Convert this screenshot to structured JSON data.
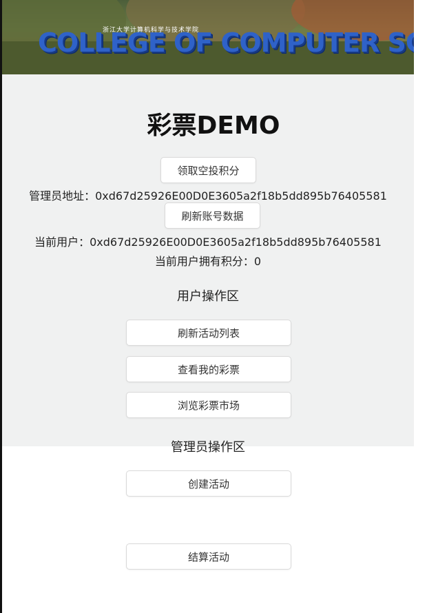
{
  "banner": {
    "subtitle": "浙江大学计算机科学与技术学院",
    "title": "COLLEGE OF COMPUTER SCIENCE"
  },
  "page": {
    "title": "彩票DEMO"
  },
  "account": {
    "airdrop_button": "领取空投积分",
    "admin_address": "管理员地址：0xd67d25926E00D0E3605a2f18b5dd895b76405581",
    "refresh_account_button": "刷新账号数据",
    "current_user": "当前用户：0xd67d25926E00D0E3605a2f18b5dd895b76405581",
    "user_points": "当前用户拥有积分：0"
  },
  "user_ops": {
    "heading": "用户操作区",
    "refresh_activities_button": "刷新活动列表",
    "my_lottery_button": "查看我的彩票",
    "lottery_market_button": "浏览彩票市场"
  },
  "admin_ops": {
    "heading": "管理员操作区",
    "create_activity_button": "创建活动",
    "settle_activity_button": "结算活动"
  }
}
